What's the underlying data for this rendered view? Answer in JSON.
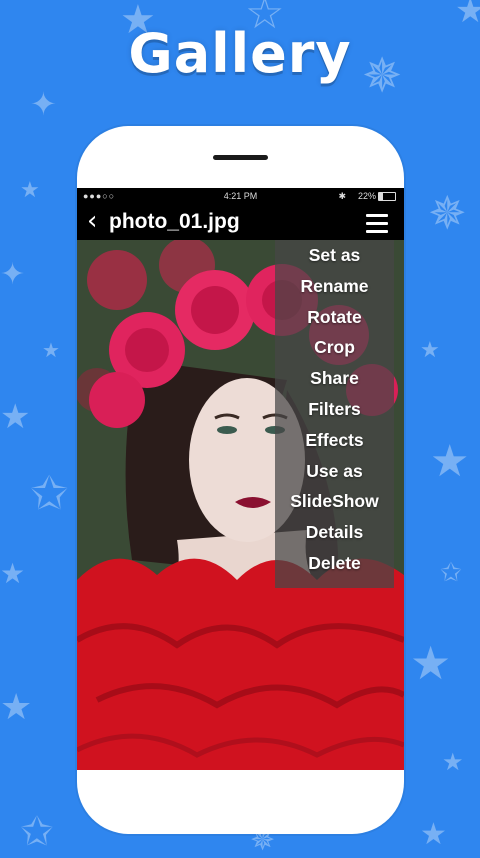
{
  "headline": "Gallery",
  "status_bar": {
    "signal": "●●●○○",
    "time": "4:21 PM",
    "bluetooth": "✱",
    "battery_percent": "22%",
    "battery_level": 0.22
  },
  "app_bar": {
    "back_glyph": "‹",
    "title": "photo_01.jpg",
    "menu_icon": "hamburger-icon"
  },
  "menu": {
    "items": [
      {
        "label": "Set as"
      },
      {
        "label": "Rename"
      },
      {
        "label": "Rotate"
      },
      {
        "label": "Crop"
      },
      {
        "label": "Share"
      },
      {
        "label": "Filters"
      },
      {
        "label": "Effects"
      },
      {
        "label": "Use as"
      },
      {
        "label": "SlideShow"
      },
      {
        "label": "Details"
      },
      {
        "label": "Delete"
      }
    ]
  },
  "colors": {
    "background": "#2f86ef",
    "menu_overlay": "rgba(70,70,70,0.72)",
    "dress": "#d0121f",
    "roses": "#e0245e"
  },
  "background_icons": [
    "star-icon"
  ]
}
